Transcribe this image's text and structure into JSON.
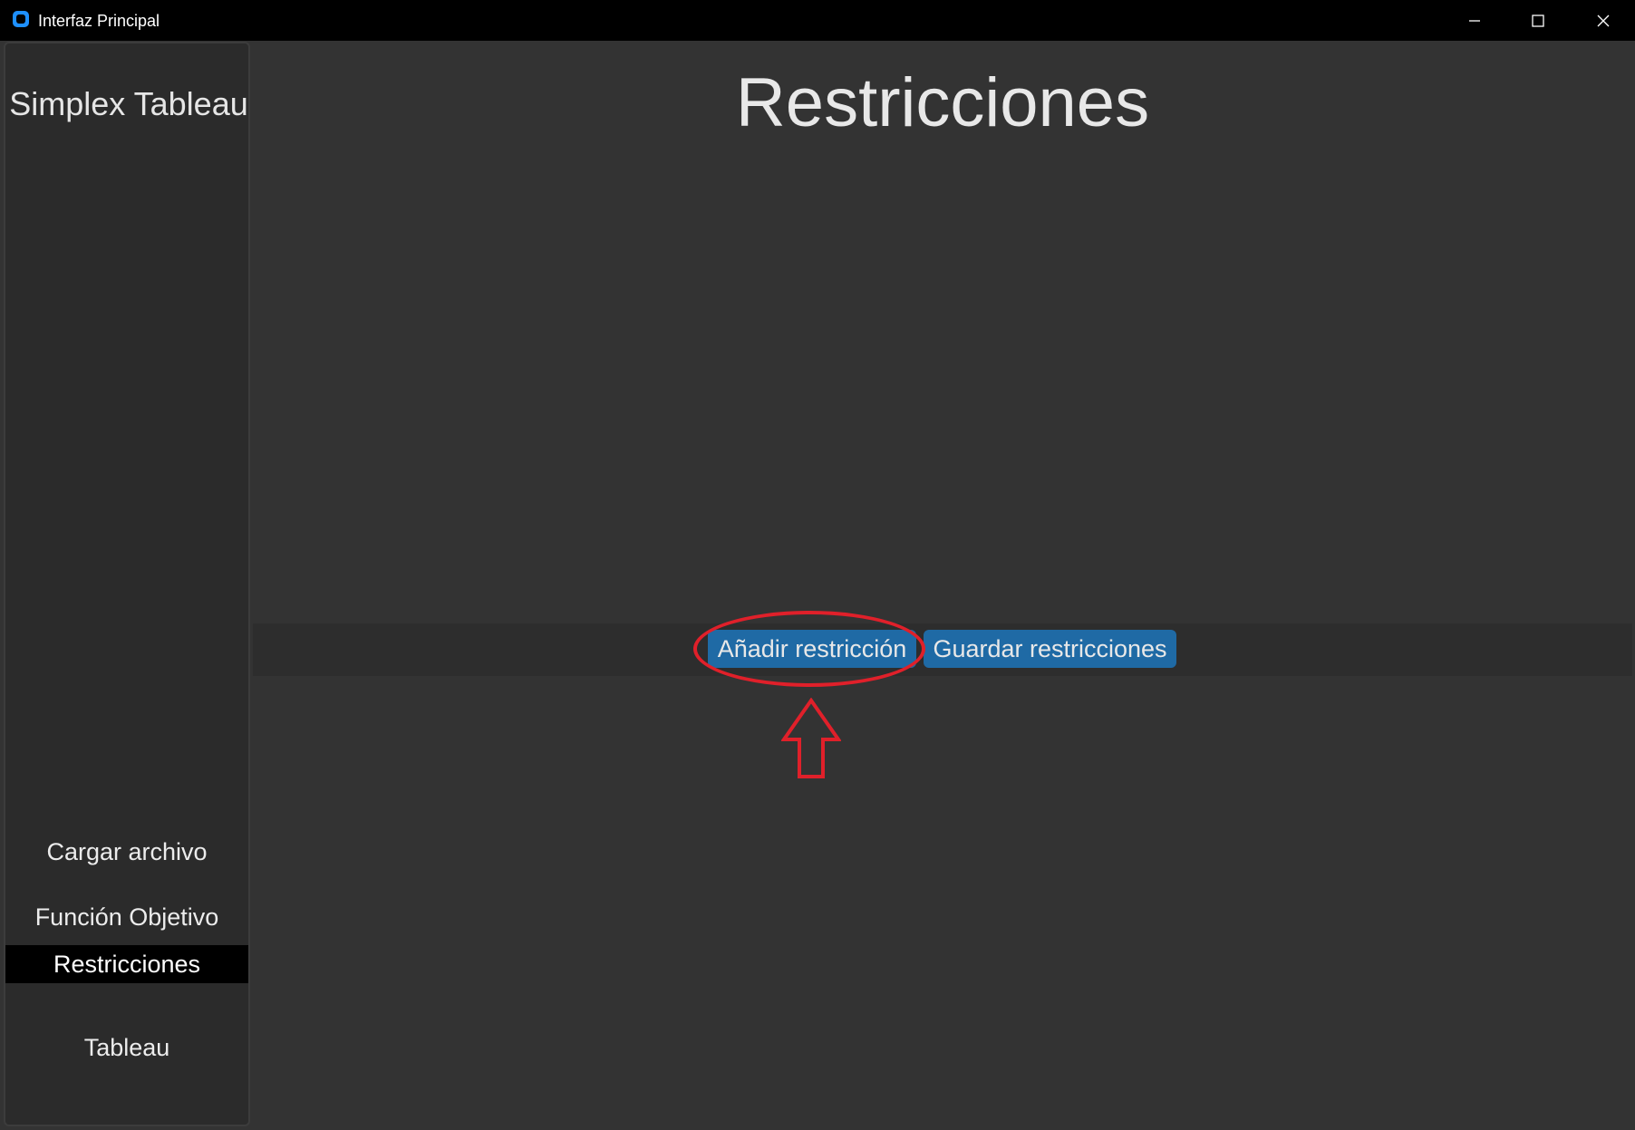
{
  "window": {
    "title": "Interfaz Principal",
    "controls": {
      "minimize": "minimize-icon",
      "maximize": "maximize-icon",
      "close": "close-icon"
    }
  },
  "sidebar": {
    "title": "Simplex Tableau",
    "items": [
      {
        "label": "Cargar archivo",
        "active": false
      },
      {
        "label": "Función Objetivo",
        "active": false
      },
      {
        "label": "Restricciones",
        "active": true
      },
      {
        "label": "Tableau",
        "active": false
      }
    ]
  },
  "main": {
    "title": "Restricciones",
    "buttons": {
      "add": "Añadir restricción",
      "save": "Guardar restricciones"
    }
  },
  "colors": {
    "background": "#333333",
    "sidebar": "#2b2b2b",
    "accent_button": "#1f6aa5",
    "active_nav": "#000000",
    "annotation": "#e0202a"
  }
}
